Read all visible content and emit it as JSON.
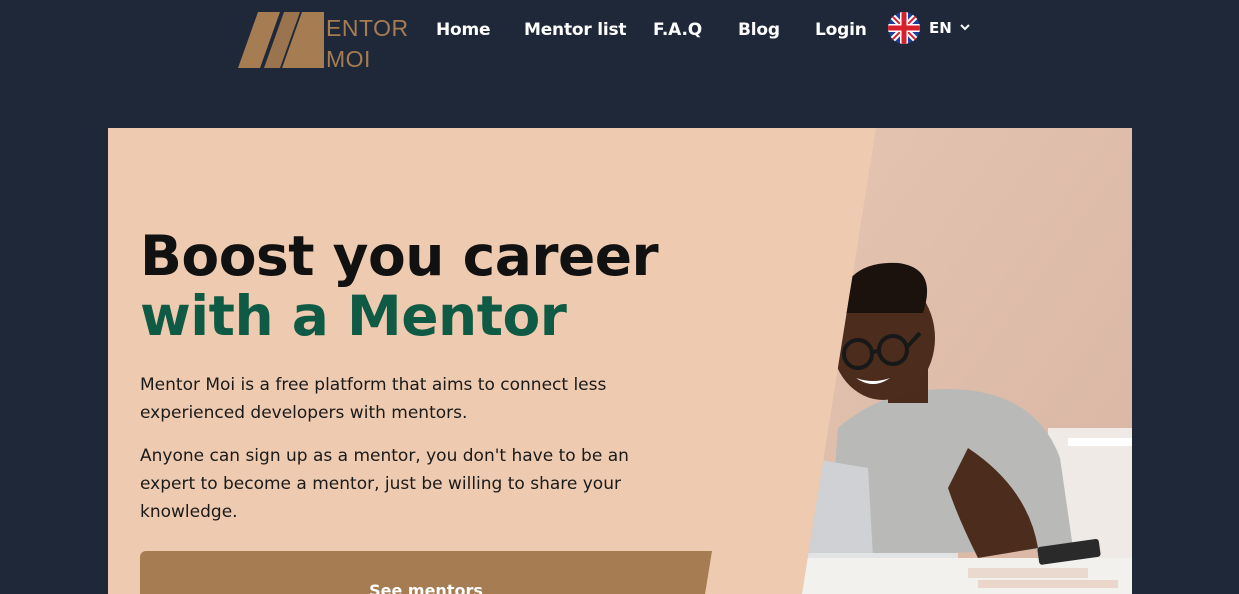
{
  "header": {
    "logo": {
      "line1": "ENTOR",
      "line2": "MOI",
      "monogram": "M"
    },
    "nav": [
      {
        "label": "Home"
      },
      {
        "label": "Mentor list"
      },
      {
        "label": "F.A.Q"
      },
      {
        "label": "Blog"
      },
      {
        "label": "Login"
      }
    ],
    "language": {
      "code": "EN",
      "flag_icon": "uk-flag-icon",
      "dropdown_icon": "chevron-down-icon"
    }
  },
  "hero": {
    "title_line1": "Boost you career",
    "title_line2": "with a Mentor",
    "paragraph1": "Mentor Moi is a free platform that aims to connect less experienced developers with mentors.",
    "paragraph2": "Anyone can sign up as a mentor, you don't have to be an expert to become a mentor, just be willing to share your knowledge.",
    "cta_label": "See mentors"
  },
  "colors": {
    "background": "#1f2839",
    "hero_bg": "#eecab0",
    "accent_brown": "#a67c52",
    "accent_green": "#0f5a44"
  }
}
